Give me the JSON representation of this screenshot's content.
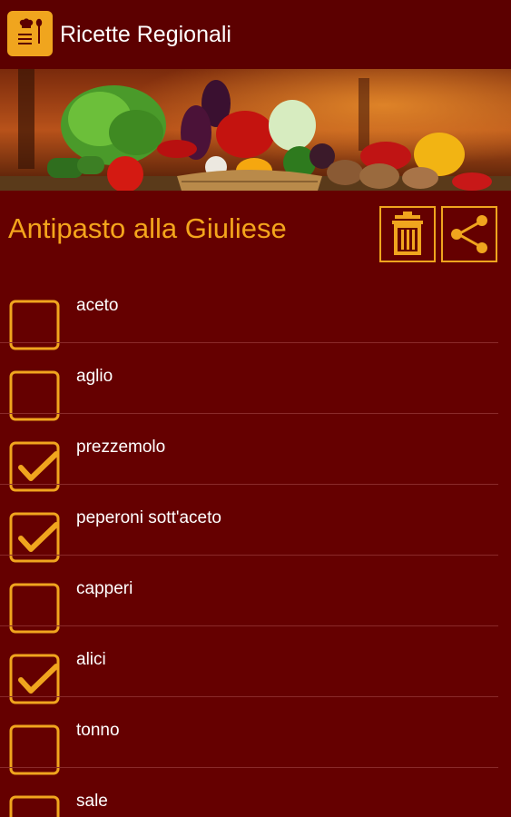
{
  "app": {
    "title": "Ricette Regionali",
    "icon": "recipe-book-icon"
  },
  "colors": {
    "background": "#650000",
    "appbar": "#5c0000",
    "accent": "#f0a51e",
    "text": "#ffffff"
  },
  "recipe": {
    "title": "Antipasto alla Giuliese"
  },
  "actions": {
    "delete_icon": "trash-icon",
    "share_icon": "share-icon"
  },
  "ingredients": [
    {
      "label": "aceto",
      "checked": false
    },
    {
      "label": "aglio",
      "checked": false
    },
    {
      "label": "prezzemolo",
      "checked": true
    },
    {
      "label": "peperoni sott'aceto",
      "checked": true
    },
    {
      "label": "capperi",
      "checked": false
    },
    {
      "label": "alici",
      "checked": true
    },
    {
      "label": "tonno",
      "checked": false
    },
    {
      "label": "sale",
      "checked": false
    }
  ]
}
